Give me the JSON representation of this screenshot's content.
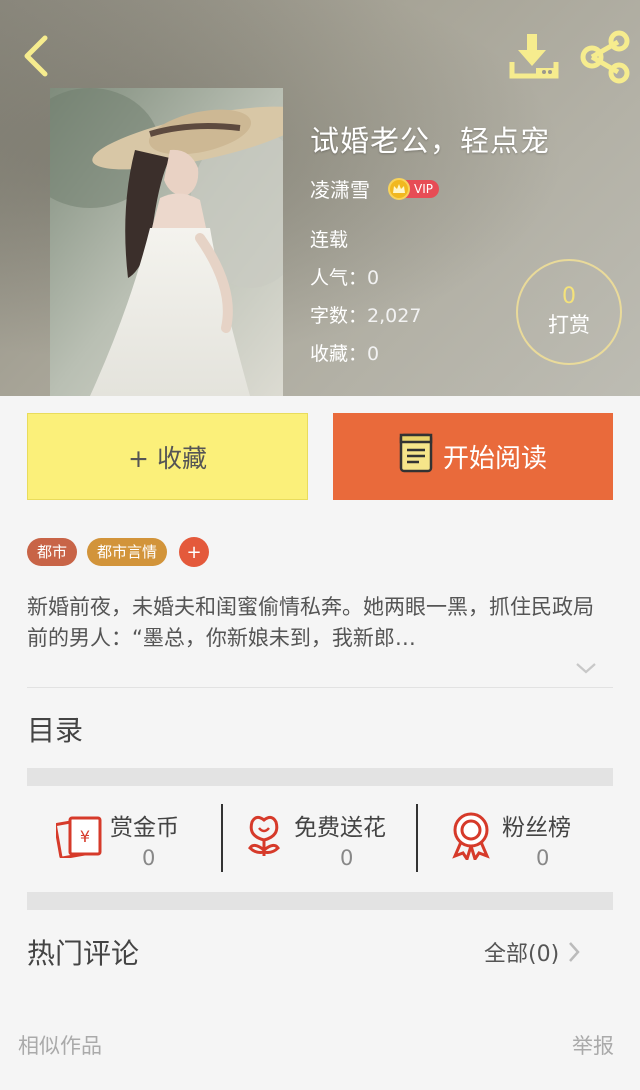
{
  "header": {
    "book_title": "试婚老公，轻点宠",
    "author": "凌潇雪",
    "vip_label": "VIP",
    "status": "连载",
    "popularity_label": "人气：",
    "popularity_value": "0",
    "word_count_label": "字数：",
    "word_count_value": "2,027",
    "favorites_label": "收藏：",
    "favorites_value": "0",
    "tip_count": "0",
    "tip_label": "打赏"
  },
  "actions": {
    "collect_label": "+ 收藏",
    "read_label": "开始阅读"
  },
  "tags": [
    "都市",
    "都市言情"
  ],
  "tag_add": "+",
  "description": "新婚前夜，未婚夫和闺蜜偷情私奔。她两眼一黑，抓住民政局前的男人：“墨总，你新娘未到，我新郎…",
  "catalog_title": "目录",
  "stats": [
    {
      "label": "赏金币",
      "count": "0",
      "icon": "red-envelope-icon"
    },
    {
      "label": "免费送花",
      "count": "0",
      "icon": "flower-icon"
    },
    {
      "label": "粉丝榜",
      "count": "0",
      "icon": "award-ribbon-icon"
    }
  ],
  "comments": {
    "title": "热门评论",
    "all_label": "全部(0)"
  },
  "footer": {
    "similar_label": "相似作品",
    "report_label": "举报"
  },
  "colors": {
    "collect_bg": "#fbf07a",
    "read_bg": "#e96a3b",
    "tag_city": "#c86447",
    "tag_romance": "#d2943a",
    "icon_red": "#d63a2a",
    "tip_accent": "#f4e27a"
  }
}
